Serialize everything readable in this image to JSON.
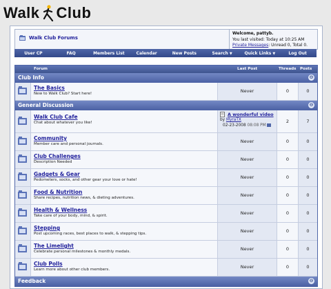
{
  "site": {
    "logo_left": "Walk",
    "logo_right": "Club"
  },
  "header": {
    "forum_title": "Walk Club Forums",
    "welcome": "Welcome, pattyb.",
    "last_visited": "You last visited: Today at 10:25 AM",
    "pm_link": "Private Messages",
    "pm_counts": ": Unread 0, Total 0."
  },
  "menu": [
    {
      "label": "User CP"
    },
    {
      "label": "FAQ"
    },
    {
      "label": "Members List"
    },
    {
      "label": "Calendar"
    },
    {
      "label": "New Posts"
    },
    {
      "label": "Search",
      "caret": "▼"
    },
    {
      "label": "Quick Links",
      "caret": "▼"
    },
    {
      "label": "Log Out"
    }
  ],
  "columns": {
    "forum": "Forum",
    "last_post": "Last Post",
    "threads": "Threads",
    "posts": "Posts"
  },
  "categories": {
    "info": {
      "name": "Club Info",
      "toggle": "⊖"
    },
    "general": {
      "name": "General Discussion",
      "toggle": "⊖"
    },
    "feedback": {
      "name": "Feedback",
      "toggle": "⊖"
    }
  },
  "forums": [
    {
      "name": "The Basics",
      "desc": "New to Walk Club? Start here!",
      "last": "Never",
      "threads": "0",
      "posts": "0"
    },
    {
      "name": "Walk Club Cafe",
      "desc": "Chat about whatever you like!",
      "last_title": "A wonderful video",
      "last_by_prefix": "by ",
      "last_by": "MyraTX",
      "last_date": "02-23-2008",
      "last_time": "08:08 PM",
      "threads": "2",
      "posts": "7"
    },
    {
      "name": "Community",
      "desc": "Member care and personal journals.",
      "last": "Never",
      "threads": "0",
      "posts": "0"
    },
    {
      "name": "Club Challenges",
      "desc": "Description Needed",
      "last": "Never",
      "threads": "0",
      "posts": "0"
    },
    {
      "name": "Gadgets & Gear",
      "desc": "Pedometers, socks, and other gear your love or hate!",
      "last": "Never",
      "threads": "0",
      "posts": "0"
    },
    {
      "name": "Food & Nutrition",
      "desc": "Share recipes, nutrition news, & dieting adventures.",
      "last": "Never",
      "threads": "0",
      "posts": "0"
    },
    {
      "name": "Health & Wellness",
      "desc": "Take care of your body, mind, & spirit.",
      "last": "Never",
      "threads": "0",
      "posts": "0"
    },
    {
      "name": "Stepping",
      "desc": "Post upcoming races, best places to walk, & stepping tips.",
      "last": "Never",
      "threads": "0",
      "posts": "0"
    },
    {
      "name": "The Limelight",
      "desc": "Celebrate personal milestones & monthly medals.",
      "last": "Never",
      "threads": "0",
      "posts": "0"
    },
    {
      "name": "Club Polls",
      "desc": "Learn more about other club members.",
      "last": "Never",
      "threads": "0",
      "posts": "0"
    }
  ],
  "colors": {
    "nav_blue": "#4f66a8",
    "link_blue": "#22229c",
    "category_blue": "#5f75b5"
  }
}
